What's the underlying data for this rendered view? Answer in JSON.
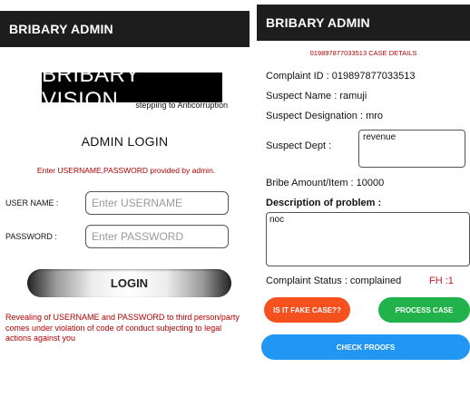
{
  "login_screen": {
    "app_title": "BRIBARY ADMIN",
    "logo_text": "BRIBARY VISION",
    "tagline": "stepping to Anticorruption",
    "heading": "ADMIN LOGIN",
    "instruction": "Enter USERNAME,PASSWORD provided by admin.",
    "username_label": "USER NAME :",
    "username_placeholder": "Enter USERNAME",
    "password_label": "PASSWORD :",
    "password_placeholder": "Enter PASSWORD",
    "login_button": "LOGIN",
    "warning": "Revealing of USERNAME and PASSWORD to third person/party comes under violation of code of conduct subjecting to legal actions against you"
  },
  "case_screen": {
    "app_title": "BRIBARY ADMIN",
    "case_header": "019897877033513 CASE DETAILS",
    "complaint_id": "Complaint ID : 019897877033513",
    "suspect_name": "Suspect Name : ramuji",
    "suspect_designation": "Suspect Designation : mro",
    "suspect_dept_label": "Suspect Dept :",
    "suspect_dept_value": "revenue",
    "bribe_amount": "Bribe Amount/Item : 10000",
    "description_label": "Description of problem :",
    "description_value": "noc",
    "complaint_status": "Complaint Status : complained",
    "fh": "FH :1",
    "fake_case_button": "IS IT FAKE CASE??",
    "process_case_button": "PROCESS CASE",
    "check_proofs_button": "CHECK PROOFS"
  },
  "colors": {
    "app_bar": "#1d1d1d",
    "warning_text": "#b00000",
    "fake_button": "#f4511e",
    "process_button": "#21b24b",
    "proofs_button": "#2196f3",
    "fh_text": "#c8161d"
  }
}
